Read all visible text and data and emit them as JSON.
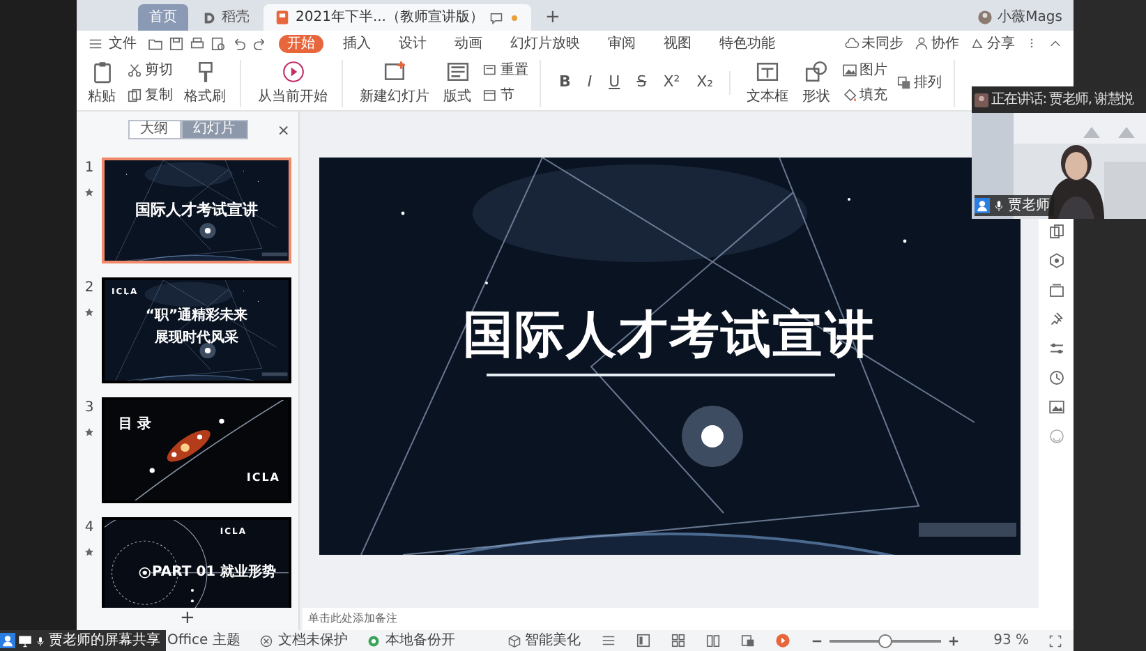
{
  "tabs": [
    {
      "label": "首页",
      "kind": "home",
      "selected": false
    },
    {
      "label": "稻壳",
      "kind": "app",
      "selected": false
    },
    {
      "label": "2021年下半...（教师宣讲版）",
      "kind": "doc",
      "selected": true
    }
  ],
  "new_tab": "+",
  "user": "小薇Mags",
  "menu": {
    "file": "文件",
    "items": [
      {
        "label": "开始",
        "selected": true
      },
      {
        "label": "插入",
        "selected": false
      },
      {
        "label": "设计",
        "selected": false
      },
      {
        "label": "动画",
        "selected": false
      },
      {
        "label": "幻灯片放映",
        "selected": false
      },
      {
        "label": "审阅",
        "selected": false
      },
      {
        "label": "视图",
        "selected": false
      },
      {
        "label": "特色功能",
        "selected": false
      }
    ],
    "actions": [
      "未同步",
      "协作",
      "分享"
    ]
  },
  "ribbon": {
    "groups": [
      {
        "items": [
          {
            "label": "粘贴",
            "kind": "large"
          },
          {
            "label": "剪切",
            "kind": "small"
          },
          {
            "label": "复制",
            "kind": "small"
          },
          {
            "label": "格式刷",
            "kind": "large"
          }
        ]
      },
      {
        "items": [
          {
            "label": "从当前开始",
            "kind": "large"
          }
        ]
      },
      {
        "items": [
          {
            "label": "新建幻灯片",
            "kind": "large"
          },
          {
            "label": "版式",
            "kind": "large"
          },
          {
            "label": "重置",
            "kind": "small"
          },
          {
            "label": "节",
            "kind": "small"
          }
        ]
      },
      {
        "items": [
          {
            "label": "B",
            "kind": "format"
          },
          {
            "label": "I",
            "kind": "format"
          },
          {
            "label": "U",
            "kind": "format"
          },
          {
            "label": "S",
            "kind": "format"
          },
          {
            "label": "X²",
            "kind": "format"
          },
          {
            "label": "X₂",
            "kind": "format"
          }
        ]
      },
      {
        "items": [
          {
            "label": "文本框",
            "kind": "large"
          },
          {
            "label": "形状",
            "kind": "large"
          },
          {
            "label": "图片",
            "kind": "small"
          },
          {
            "label": "填充",
            "kind": "small"
          },
          {
            "label": "排列",
            "kind": "small"
          }
        ]
      }
    ]
  },
  "panel": {
    "tabs": [
      {
        "label": "大纲",
        "selected": false
      },
      {
        "label": "幻灯片",
        "selected": true
      }
    ],
    "close": "×",
    "add": "+"
  },
  "slides": [
    {
      "number": "1",
      "kind": "space",
      "selected": true,
      "title": "国际人才考试宣讲"
    },
    {
      "number": "2",
      "kind": "space",
      "selected": false,
      "logo": "ICLA",
      "title": "“职”通精彩未来",
      "subtitle": "展现时代风采"
    },
    {
      "number": "3",
      "kind": "agenda",
      "selected": false,
      "title": "目 录",
      "logo": "ICLA"
    },
    {
      "number": "4",
      "kind": "part",
      "selected": false,
      "logo": "ICLA",
      "title": "PART 01 就业形势"
    }
  ],
  "current_slide": {
    "title": "国际人才考试宣讲"
  },
  "notes": {
    "placeholder": "单击此处添加备注"
  },
  "status": {
    "items": [
      "Office 主题",
      "文档未保护",
      "本地备份开"
    ],
    "beautify": "智能美化",
    "zoom": {
      "level": 0.5,
      "reading": "93 %"
    }
  },
  "meeting": {
    "speaking": "正在讲话: 贾老师, 谢慧悦",
    "video_name": "贾老师",
    "share_label": "贾老师的屏幕共享"
  }
}
